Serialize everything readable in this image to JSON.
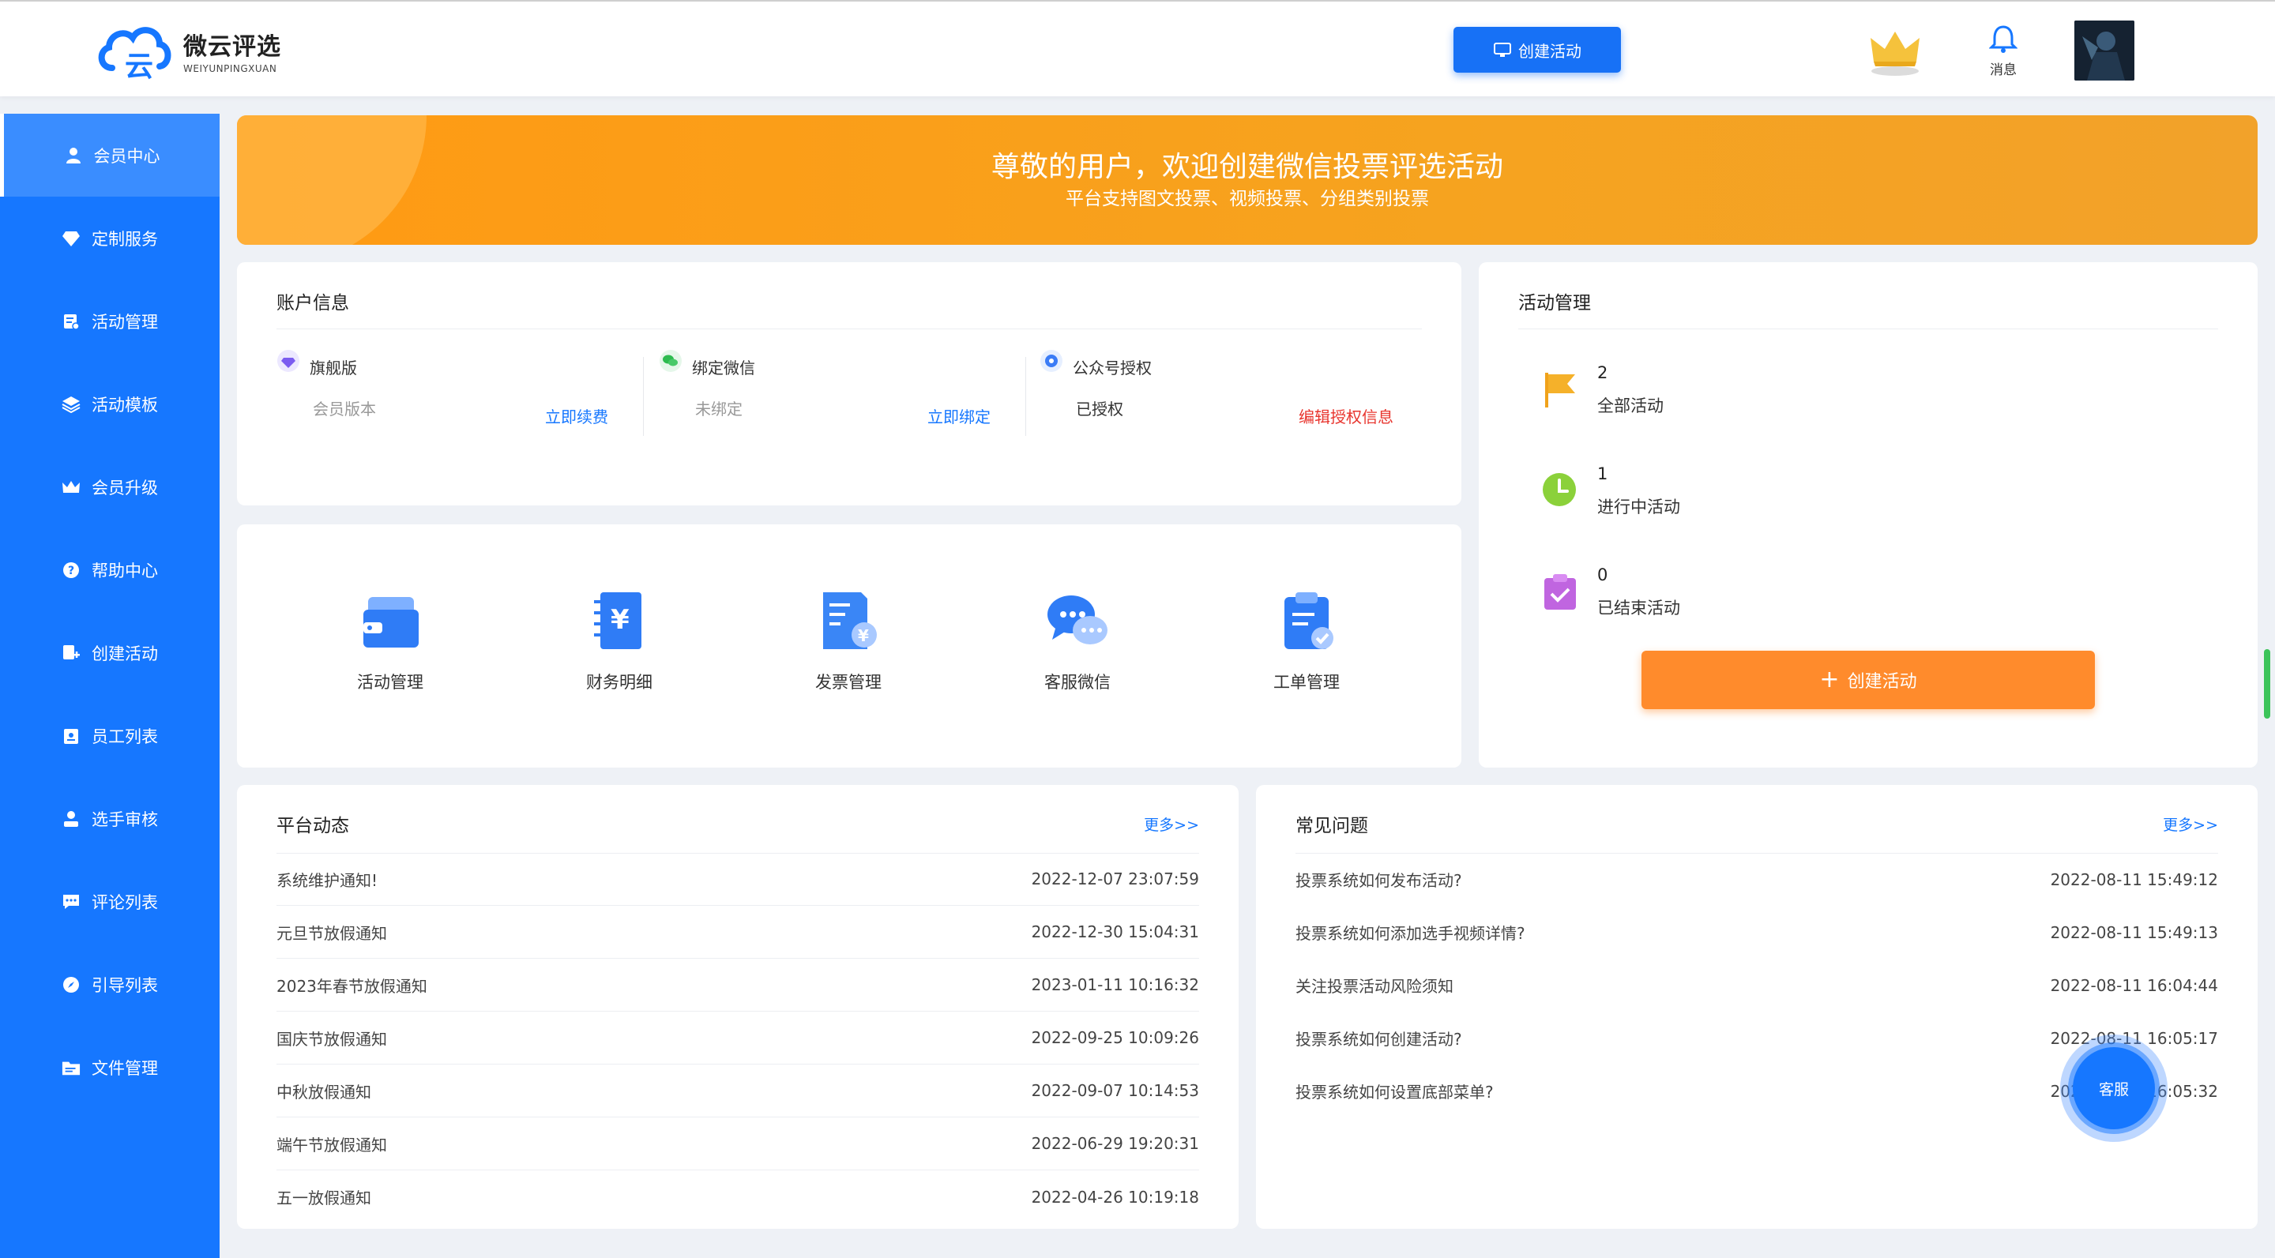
{
  "header": {
    "logo_title": "微云评选",
    "logo_sub": "WEIYUNPINGXUAN",
    "create_label": "创建活动",
    "message_label": "消息"
  },
  "sidebar": {
    "items": [
      {
        "label": "会员中心",
        "icon": "user-icon"
      },
      {
        "label": "定制服务",
        "icon": "diamond-icon"
      },
      {
        "label": "活动管理",
        "icon": "activity-icon"
      },
      {
        "label": "活动模板",
        "icon": "layers-icon"
      },
      {
        "label": "会员升级",
        "icon": "crown-icon"
      },
      {
        "label": "帮助中心",
        "icon": "help-icon"
      },
      {
        "label": "创建活动",
        "icon": "create-icon"
      },
      {
        "label": "员工列表",
        "icon": "badge-icon"
      },
      {
        "label": "选手审核",
        "icon": "audit-icon"
      },
      {
        "label": "评论列表",
        "icon": "comment-icon"
      },
      {
        "label": "引导列表",
        "icon": "compass-icon"
      },
      {
        "label": "文件管理",
        "icon": "folder-icon"
      }
    ]
  },
  "banner": {
    "title": "尊敬的用户，欢迎创建微信投票评选活动",
    "subtitle": "平台支持图文投票、视频投票、分组类别投票"
  },
  "account": {
    "title": "账户信息",
    "cols": [
      {
        "name": "旗舰版",
        "value": "会员版本",
        "link": "立即续费"
      },
      {
        "name": "绑定微信",
        "value": "未绑定",
        "link": "立即绑定"
      },
      {
        "name": "公众号授权",
        "value": "已授权",
        "link": "编辑授权信息"
      }
    ]
  },
  "tools": [
    {
      "label": "活动管理",
      "icon": "wallet-icon"
    },
    {
      "label": "财务明细",
      "icon": "finance-icon"
    },
    {
      "label": "发票管理",
      "icon": "invoice-icon"
    },
    {
      "label": "客服微信",
      "icon": "chat-icon"
    },
    {
      "label": "工单管理",
      "icon": "clipboard-icon"
    }
  ],
  "activity": {
    "title": "活动管理",
    "stats": [
      {
        "num": "2",
        "label": "全部活动",
        "icon": "flag-icon"
      },
      {
        "num": "1",
        "label": "进行中活动",
        "icon": "clock-icon"
      },
      {
        "num": "0",
        "label": "已结束活动",
        "icon": "check-icon"
      }
    ],
    "create_label": "创建活动"
  },
  "news": {
    "title": "平台动态",
    "more": "更多>>",
    "rows": [
      {
        "title": "系统维护通知!",
        "date": "2022-12-07 23:07:59"
      },
      {
        "title": "元旦节放假通知",
        "date": "2022-12-30 15:04:31"
      },
      {
        "title": "2023年春节放假通知",
        "date": "2023-01-11 10:16:32"
      },
      {
        "title": "国庆节放假通知",
        "date": "2022-09-25 10:09:26"
      },
      {
        "title": "中秋放假通知",
        "date": "2022-09-07 10:14:53"
      },
      {
        "title": "端午节放假通知",
        "date": "2022-06-29 19:20:31"
      },
      {
        "title": "五一放假通知",
        "date": "2022-04-26 10:19:18"
      }
    ]
  },
  "faq": {
    "title": "常见问题",
    "more": "更多>>",
    "rows": [
      {
        "title": "投票系统如何发布活动?",
        "date": "2022-08-11 15:49:12"
      },
      {
        "title": "投票系统如何添加选手视频详情?",
        "date": "2022-08-11 15:49:13"
      },
      {
        "title": "关注投票活动风险须知",
        "date": "2022-08-11 16:04:44"
      },
      {
        "title": "投票系统如何创建活动?",
        "date": "2022-08-11 16:05:17"
      },
      {
        "title": "投票系统如何设置底部菜单?",
        "date": "2022-08-11 16:05:32"
      }
    ]
  },
  "service_label": "客服",
  "colors": {
    "primary": "#1677ff",
    "orange": "#ff8b2c",
    "banner": "#f6a31f"
  }
}
